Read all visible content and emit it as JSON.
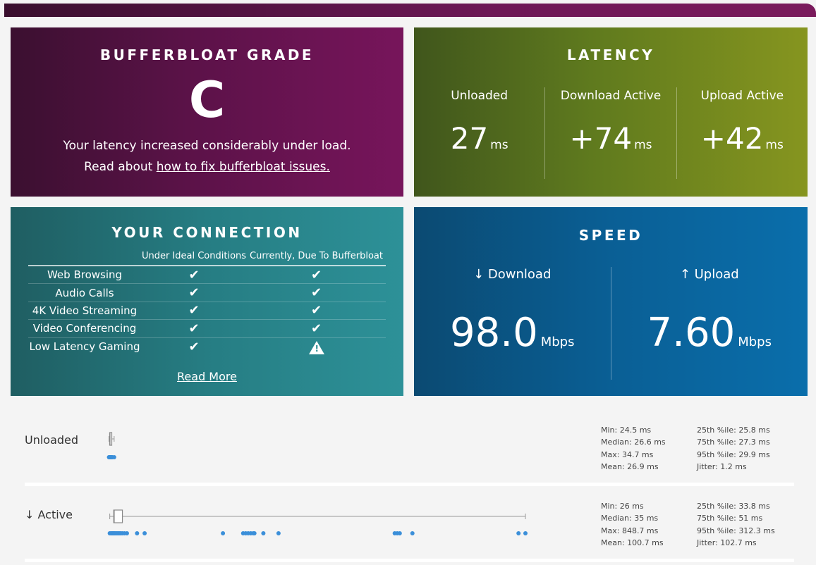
{
  "grade": {
    "title": "BUFFERBLOAT GRADE",
    "letter": "C",
    "message": "Your latency increased considerably under load.",
    "read_prefix": "Read about ",
    "read_link": "how to fix bufferbloat issues."
  },
  "latency": {
    "title": "LATENCY",
    "columns": [
      {
        "label": "Unloaded",
        "value": "27",
        "unit": "ms"
      },
      {
        "label": "Download Active",
        "value": "+74",
        "unit": "ms"
      },
      {
        "label": "Upload Active",
        "value": "+42",
        "unit": "ms"
      }
    ]
  },
  "connection": {
    "title": "YOUR CONNECTION",
    "col_ideal": "Under Ideal Conditions",
    "col_current": "Currently, Due To Bufferbloat",
    "rows": [
      {
        "label": "Web Browsing",
        "ideal": "ok",
        "current": "ok"
      },
      {
        "label": "Audio Calls",
        "ideal": "ok",
        "current": "ok"
      },
      {
        "label": "4K Video Streaming",
        "ideal": "ok",
        "current": "ok"
      },
      {
        "label": "Video Conferencing",
        "ideal": "ok",
        "current": "ok"
      },
      {
        "label": "Low Latency Gaming",
        "ideal": "ok",
        "current": "warning"
      }
    ],
    "read_more": "Read More"
  },
  "speed": {
    "title": "SPEED",
    "download": {
      "label": "↓ Download",
      "value": "98.0",
      "unit": "Mbps"
    },
    "upload": {
      "label": "↑ Upload",
      "value": "7.60",
      "unit": "Mbps"
    }
  },
  "details": {
    "unloaded": {
      "label": "Unloaded",
      "stats_left": [
        "Min: 24.5 ms",
        "Median: 26.6 ms",
        "Max: 34.7 ms",
        "Mean: 26.9 ms"
      ],
      "stats_right": [
        "25th %ile: 25.8 ms",
        "75th %ile: 27.3 ms",
        "95th %ile: 29.9 ms",
        "Jitter: 1.2 ms"
      ]
    },
    "active": {
      "label": "↓ Active",
      "stats_left": [
        "Min: 26 ms",
        "Median: 35 ms",
        "Max: 848.7 ms",
        "Mean: 100.7 ms"
      ],
      "stats_right": [
        "25th %ile: 33.8 ms",
        "75th %ile: 51 ms",
        "95th %ile: 312.3 ms",
        "Jitter: 102.7 ms"
      ]
    }
  },
  "chart_data": [
    {
      "type": "scatter",
      "name": "Unloaded",
      "box": {
        "min": 24.5,
        "q1": 25.8,
        "median": 26.6,
        "q3": 27.3,
        "max": 34.7
      },
      "points": [
        24.5,
        25.0,
        25.5,
        25.8,
        26.0,
        26.3,
        26.6,
        26.8,
        27.0,
        27.3,
        27.8,
        28.5,
        29.9,
        31.0,
        34.7
      ],
      "xlim": [
        0,
        848.7
      ]
    },
    {
      "type": "scatter",
      "name": "↓ Active",
      "box": {
        "min": 26,
        "q1": 33.8,
        "median": 35,
        "q3": 51,
        "max": 848.7
      },
      "points": [
        26,
        28,
        30,
        31,
        32,
        33,
        33.8,
        34,
        35,
        36,
        38,
        40,
        42,
        44,
        46,
        48,
        51,
        55,
        60,
        80,
        95,
        250,
        290,
        295,
        300,
        305,
        310,
        312.3,
        330,
        360,
        590,
        595,
        600,
        625,
        835,
        848.7
      ],
      "xlim": [
        0,
        848.7
      ]
    }
  ]
}
